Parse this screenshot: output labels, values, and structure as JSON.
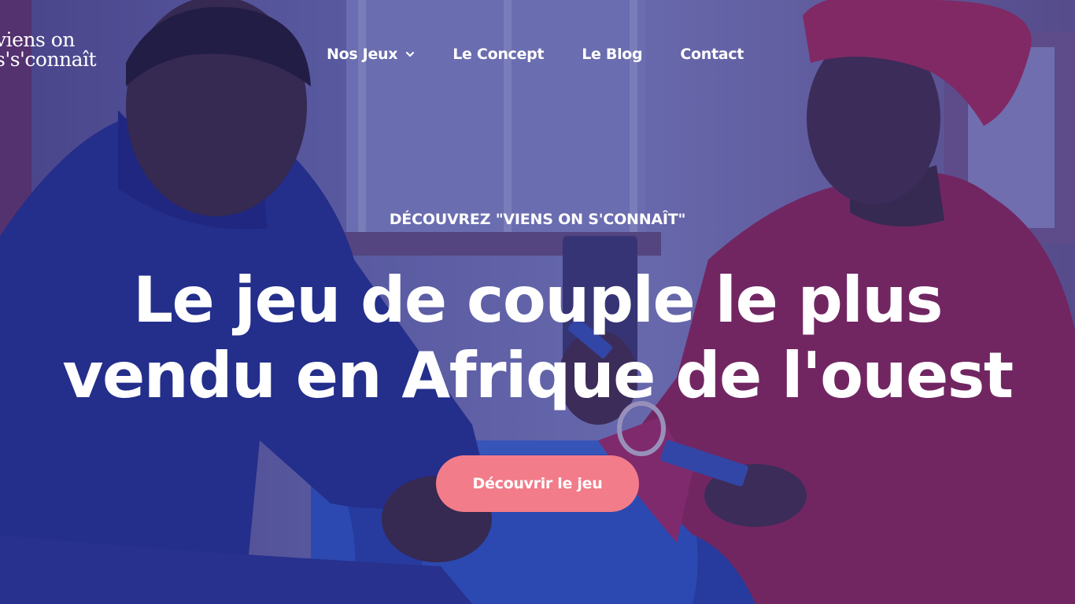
{
  "brand": {
    "logo_line1": "viens on",
    "logo_line2": "s's'connaît"
  },
  "nav": {
    "items": [
      {
        "label": "Nos Jeux",
        "has_dropdown": true,
        "icon": "chevron-down-icon"
      },
      {
        "label": "Le Concept"
      },
      {
        "label": "Le Blog"
      },
      {
        "label": "Contact"
      }
    ]
  },
  "hero": {
    "eyebrow": "DÉCOUVREZ \"VIENS ON S'CONNAÎT\"",
    "headline_line1": "Le jeu de couple le plus",
    "headline_line2": "vendu en Afrique de l'ouest",
    "cta_label": "Découvrir le jeu"
  },
  "colors": {
    "overlay": "#30348c",
    "cta_background": "#f27c8a",
    "text": "#ffffff",
    "man_sweater": "#1e2a8c",
    "woman_blouse": "#9a1d4a",
    "headwrap": "#b3234e",
    "chair_blue": "#2a56c8"
  }
}
